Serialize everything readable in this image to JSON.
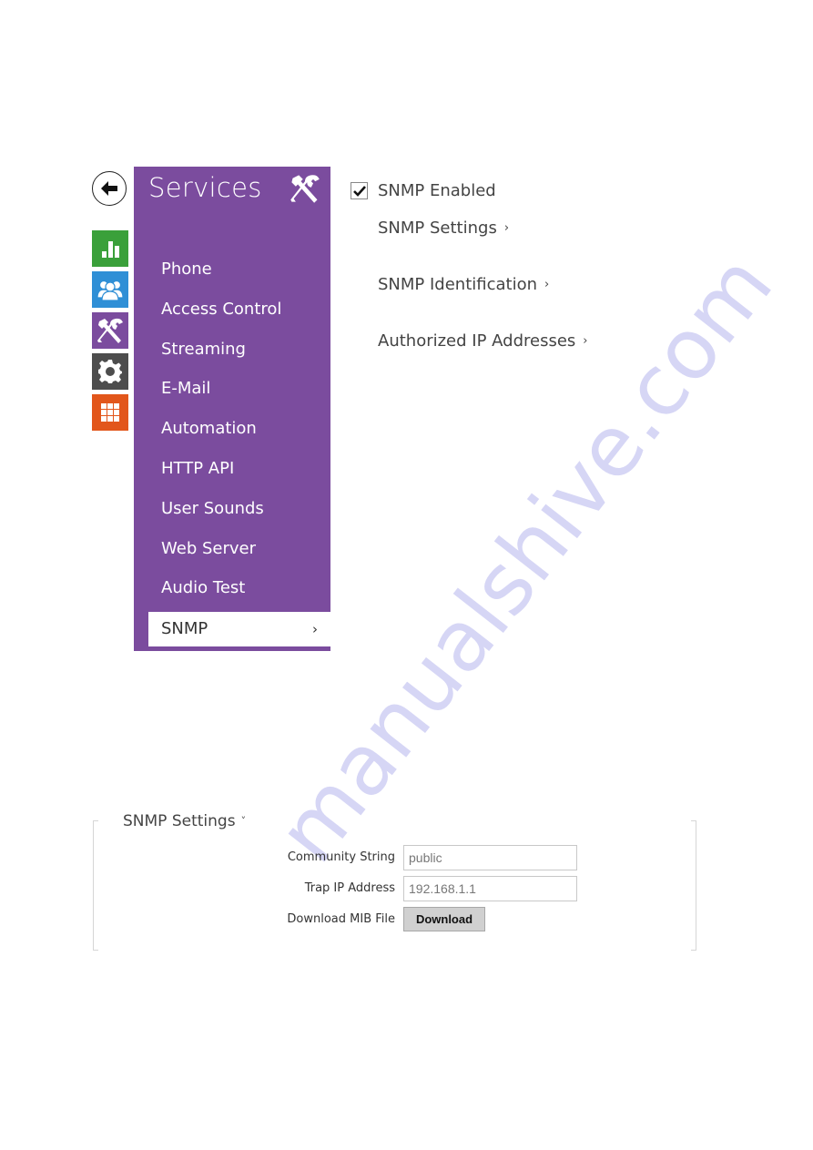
{
  "watermark": "manualshive.com",
  "nav": {
    "back_icon": "arrow-left-icon",
    "rail": [
      {
        "name": "status",
        "icon": "bar-chart-icon",
        "color": "#3aa03a"
      },
      {
        "name": "directory",
        "icon": "users-icon",
        "color": "#2f8fd6"
      },
      {
        "name": "services",
        "icon": "tools-icon",
        "color": "#7b4c9e"
      },
      {
        "name": "system",
        "icon": "gear-icon",
        "color": "#4d4d4d"
      },
      {
        "name": "applications",
        "icon": "grid-icon",
        "color": "#e2561b"
      }
    ]
  },
  "panel": {
    "title": "Services",
    "title_icon": "tools-icon",
    "accent": "#7b4c9e",
    "items": [
      {
        "label": "Phone"
      },
      {
        "label": "Access Control"
      },
      {
        "label": "Streaming"
      },
      {
        "label": "E-Mail"
      },
      {
        "label": "Automation"
      },
      {
        "label": "HTTP API"
      },
      {
        "label": "User Sounds"
      },
      {
        "label": "Web Server"
      },
      {
        "label": "Audio Test"
      },
      {
        "label": "SNMP",
        "active": true,
        "chevron": "›"
      }
    ]
  },
  "content": {
    "snmp_enabled": {
      "label": "SNMP Enabled",
      "checked": true
    },
    "sections": [
      {
        "label": "SNMP Settings",
        "chevron": "›"
      },
      {
        "label": "SNMP Identification",
        "chevron": "›"
      },
      {
        "label": "Authorized IP Addresses",
        "chevron": "›"
      }
    ]
  },
  "settings_panel": {
    "title": "SNMP Settings",
    "chevron": "˅",
    "fields": [
      {
        "label": "Community String",
        "value": "public"
      },
      {
        "label": "Trap IP Address",
        "value": "192.168.1.1"
      }
    ],
    "mib": {
      "label": "Download MIB File",
      "button": "Download"
    }
  }
}
